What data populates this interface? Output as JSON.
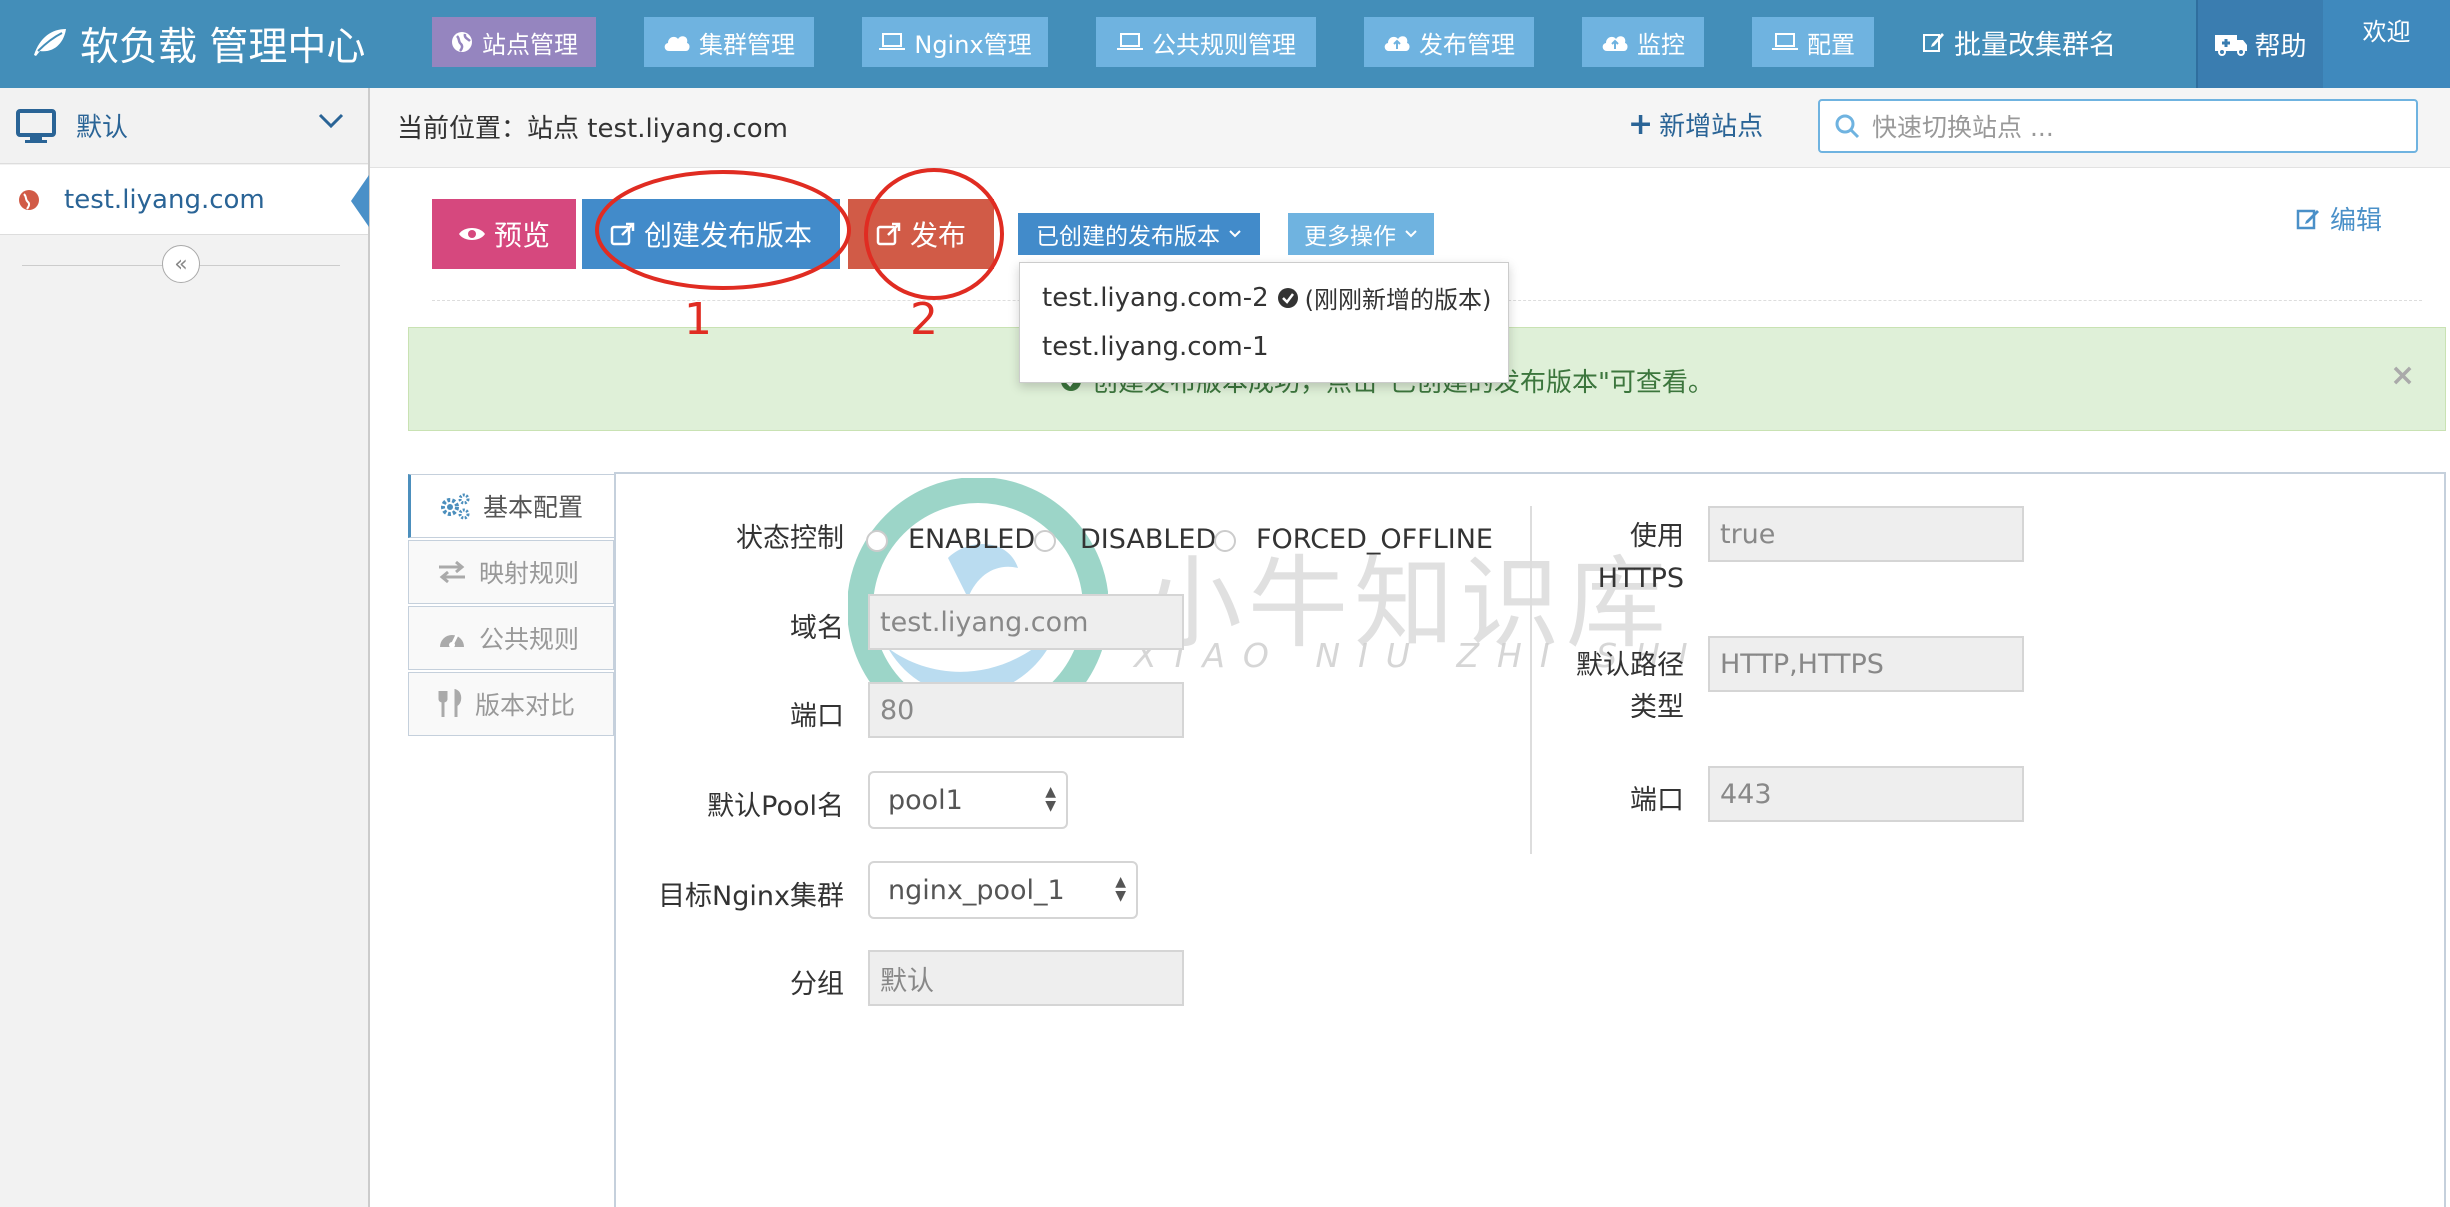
{
  "brand": {
    "title": "软负载 管理中心",
    "icon": "leaf-icon"
  },
  "nav": {
    "items": [
      {
        "label": "站点管理",
        "icon": "globe-icon",
        "active": true
      },
      {
        "label": "集群管理",
        "icon": "cloud-icon"
      },
      {
        "label": "Nginx管理",
        "icon": "laptop-icon"
      },
      {
        "label": "公共规则管理",
        "icon": "laptop-icon"
      },
      {
        "label": "发布管理",
        "icon": "cloud-upload-icon"
      },
      {
        "label": "监控",
        "icon": "cloud-upload-icon"
      },
      {
        "label": "配置",
        "icon": "laptop-icon"
      }
    ],
    "batch_rename": "批量改集群名",
    "help": "帮助",
    "welcome": "欢迎"
  },
  "sidebar": {
    "group": "默认",
    "site": "test.liyang.com",
    "collapse": "«"
  },
  "breadcrumb": {
    "text": "当前位置：站点 test.liyang.com",
    "add_site": "新增站点",
    "search_placeholder": "快速切换站点 ..."
  },
  "toolbar": {
    "preview": "预览",
    "create_version": "创建发布版本",
    "publish": "发布",
    "created_versions": "已创建的发布版本",
    "more_actions": "更多操作",
    "edit": "编辑"
  },
  "dropdown": {
    "items": [
      {
        "label": "test.liyang.com-2",
        "note": "(刚刚新增的版本)"
      },
      {
        "label": "test.liyang.com-1"
      }
    ]
  },
  "alert": {
    "message": "创建发布版本成功，点击\"已创建的发布版本\"可查看。",
    "close": "×"
  },
  "annotations": {
    "one": "1",
    "two": "2"
  },
  "tabs": [
    {
      "label": "基本配置",
      "icon": "gears-icon",
      "active": true
    },
    {
      "label": "映射规则",
      "icon": "exchange-icon"
    },
    {
      "label": "公共规则",
      "icon": "dashboard-icon"
    },
    {
      "label": "版本对比",
      "icon": "cutlery-icon"
    }
  ],
  "form": {
    "status_label": "状态控制",
    "status_options": [
      "ENABLED",
      "DISABLED",
      "FORCED_OFFLINE"
    ],
    "domain_label": "域名",
    "domain_value": "test.liyang.com",
    "port_label": "端口",
    "port_value": "80",
    "pool_label": "默认Pool名",
    "pool_value": "pool1",
    "cluster_label": "目标Nginx集群",
    "cluster_value": "nginx_pool_1",
    "group_label": "分组",
    "group_value": "默认",
    "https_label_1": "使用",
    "https_label_2": "HTTPS",
    "https_value": "true",
    "path_type_label_1": "默认路径",
    "path_type_label_2": "类型",
    "path_type_value": "HTTP,HTTPS",
    "https_port_label": "端口",
    "https_port_value": "443"
  },
  "watermark": {
    "text": "小牛知识库",
    "sub": "XIAO NIU ZHI SHI KU"
  },
  "colors": {
    "nav": "#438eb9",
    "nav_button": "#6fb3e0",
    "nav_active": "#9585bf",
    "preview": "#d6487e",
    "create": "#428bca",
    "publish": "#d15b47",
    "annotation": "#e02c22",
    "alert_bg": "#dff0d8"
  }
}
